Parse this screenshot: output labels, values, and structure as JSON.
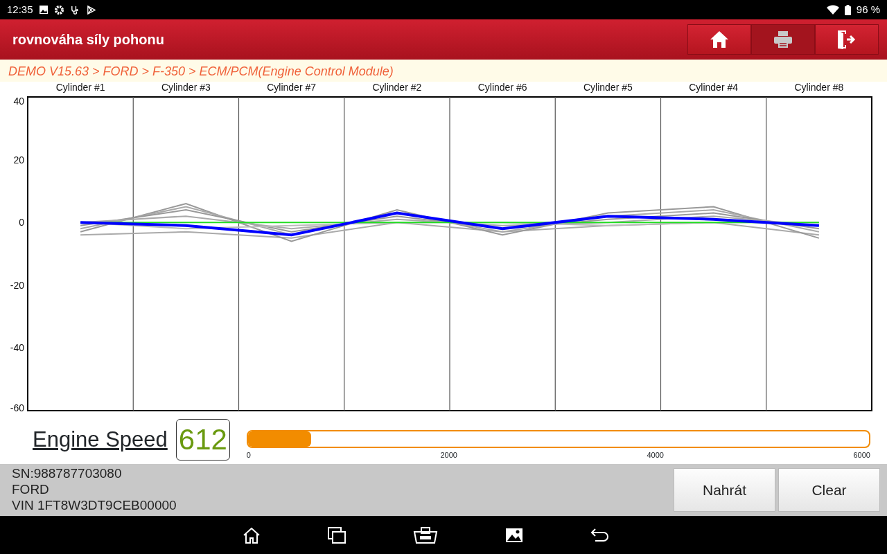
{
  "status_bar": {
    "time": "12:35",
    "battery": "96 %"
  },
  "header": {
    "title": "rovnováha síly pohonu",
    "buttons": [
      {
        "kind": "home",
        "disabled": false
      },
      {
        "kind": "print",
        "disabled": true
      },
      {
        "kind": "exit",
        "disabled": false
      }
    ]
  },
  "breadcrumb": "DEMO V15.63 > FORD > F-350 > ECM/PCM(Engine Control Module)",
  "chart": {
    "chart_data": {
      "type": "line",
      "categories": [
        "Cylinder #1",
        "Cylinder #3",
        "Cylinder #7",
        "Cylinder #2",
        "Cylinder #6",
        "Cylinder #5",
        "Cylinder #4",
        "Cylinder #8"
      ],
      "ylim": [
        -60,
        40
      ],
      "yticks": [
        40,
        20,
        0,
        -20,
        -40,
        -60
      ],
      "series": [
        {
          "color": "#aaaaaa",
          "values": [
            -4,
            -3,
            -5,
            0,
            -3,
            -1,
            0,
            -4
          ]
        },
        {
          "color": "#999999",
          "values": [
            -3,
            6,
            -6,
            4,
            -4,
            3,
            5,
            -5
          ]
        },
        {
          "color": "#aaaaaa",
          "values": [
            -2,
            5,
            -4,
            3,
            -3,
            2,
            4,
            -3
          ]
        },
        {
          "color": "#999999",
          "values": [
            -1,
            4,
            -3,
            2,
            -2,
            1,
            3,
            -2
          ]
        },
        {
          "color": "#aaaaaa",
          "values": [
            0,
            2,
            -2,
            1,
            -1,
            0,
            2,
            -1
          ]
        },
        {
          "color": "#bbbbbb",
          "values": [
            0,
            -2,
            -1,
            0,
            0,
            -1,
            0,
            0
          ]
        },
        {
          "color": "#22dd22",
          "values": [
            0,
            0,
            0,
            0,
            0,
            0,
            0,
            0
          ]
        },
        {
          "color": "#0000ff",
          "values": [
            0,
            -1,
            -4,
            3,
            -2,
            2,
            1,
            -1
          ]
        }
      ]
    }
  },
  "engine_speed": {
    "label": "Engine Speed",
    "value": "612",
    "level": 0.102,
    "ticks": [
      "0",
      "2000",
      "4000",
      "6000"
    ]
  },
  "info": {
    "lines": [
      "SN:988787703080",
      "FORD",
      "VIN 1FT8W3DT9CEB00000"
    ],
    "buttons": [
      "Nahrát",
      "Clear"
    ]
  }
}
